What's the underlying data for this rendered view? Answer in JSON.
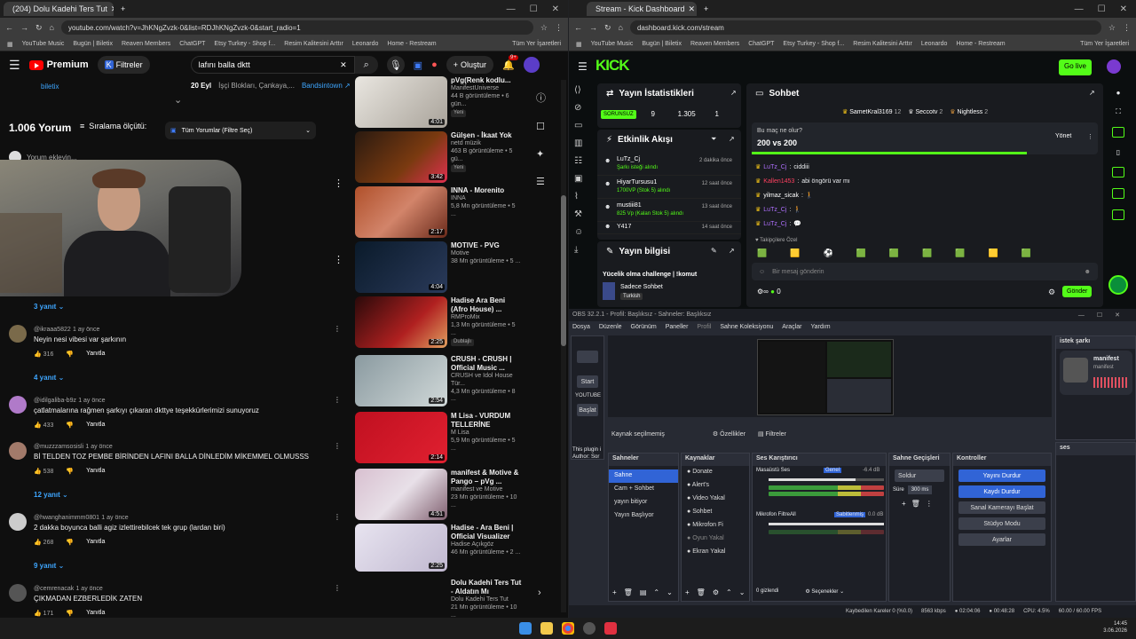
{
  "yt_browser": {
    "tab_title": "(204) Dolu Kadehi Ters Tut",
    "url": "youtube.com/watch?v=JhKNgZvzk-0&list=RDJhKNgZvzk-0&start_radio=1"
  },
  "kick_browser": {
    "tab_title": "Stream - Kick Dashboard",
    "url": "dashboard.kick.com/stream"
  },
  "bookmarks": [
    "YouTube Music",
    "Bugün | Biletix",
    "Reaven Members",
    "ChatGPT",
    "Etsy Turkey - Shop f...",
    "Resim Kalitesini Arttır",
    "Leonardo",
    "Home - Restream"
  ],
  "bookmarks_right": "Tüm Yer İşaretleri",
  "yt": {
    "brand": "Premium",
    "filters": "Filtreler",
    "search": "lafını balla dktt",
    "create": "Oluştur",
    "notif": "9+",
    "biletix": "biletix",
    "date": "20 Eyl",
    "venue": "İşçi Blokları, Çankaya,...",
    "bandsintown": "Bandsintown ↗",
    "comment_count": "1.006 Yorum",
    "sort": "Sıralama ölçütü:",
    "filter_sel": "Tüm Yorumlar (Filtre Seç)",
    "add_comment": "Yorum ekleyin...",
    "comments": [
      {
        "replies": "3 yanıt"
      },
      {
        "user": "@ikraaa5822",
        "age": "1 ay önce",
        "text": "Neyin nesi vibesi var şarkının",
        "likes": "316",
        "reply": "Yanıtla",
        "replies": "4 yanıt"
      },
      {
        "user": "@idilgaliba-b9z",
        "age": "1 ay önce",
        "text": "çatlatmalarına rağmen şarkıyı çıkaran dkttye teşekkürlerimizi sunuyoruz",
        "likes": "433",
        "reply": "Yanıtla"
      },
      {
        "user": "@muzzzamsosisli",
        "age": "1 ay önce",
        "text": "Bİ TELDEN TOZ PEMBE BİRİNDEN LAFINI BALLA DİNLEDİM MİKEMMEL OLMUSSS",
        "likes": "538",
        "reply": "Yanıtla",
        "replies": "12 yanıt"
      },
      {
        "user": "@hwanghanimmm0801",
        "age": "1 ay önce",
        "text": "2 dakka boyunca balli agiz izlettirebilcek tek grup (lardan biri)",
        "likes": "268",
        "reply": "Yanıtla",
        "replies": "9 yanıt"
      },
      {
        "user": "@cemrenacak",
        "age": "1 ay önce",
        "text": "ÇIKMADAN EZBERLEDİK ZATEN",
        "likes": "171",
        "reply": "Yanıtla"
      }
    ],
    "videos": [
      {
        "title": "pVg(Renk kodlu...",
        "channel": "ManifestUniverse",
        "meta": "44 B görüntüleme • 6 gün...",
        "badge": "Yeni",
        "dur": "4:01"
      },
      {
        "title": "Gülşen - İkaat Yok",
        "channel": "netd müzik",
        "meta": "463 B görüntüleme • 5 gü...",
        "badge": "Yeni",
        "dur": "3:42"
      },
      {
        "title": "INNA - Morenito",
        "channel": "INNA",
        "meta": "5,8 Mn görüntüleme • 5 ...",
        "badge": "",
        "dur": "2:17"
      },
      {
        "title": "MOTIVE - PVG",
        "channel": "Motive",
        "meta": "38 Mn görüntüleme • 5 ...",
        "badge": "",
        "dur": "4:04"
      },
      {
        "title": "Hadise Ara Beni (Afro House) ...",
        "channel": "RMProMix",
        "meta": "1,3 Mn görüntüleme • 5 ...",
        "badge": "Dublajlı",
        "dur": "2:25"
      },
      {
        "title": "CRUSH - CRUSH | Official Music ...",
        "channel": "CRUSH ve Idol House Tür...",
        "meta": "4,3 Mn görüntüleme • 8 ...",
        "badge": "",
        "dur": "2:54"
      },
      {
        "title": "M Lisa - VURDUM TELLERİNE",
        "channel": "M Lisa",
        "meta": "5,9 Mn görüntüleme • 5 ...",
        "badge": "",
        "dur": "2:14"
      },
      {
        "title": "manifest & Motive & Pango – pVg ...",
        "channel": "manifest ve Motive",
        "meta": "23 Mn görüntüleme • 10 ...",
        "badge": "",
        "dur": "4:51"
      },
      {
        "title": "Hadise - Ara Beni | Official Visualizer",
        "channel": "Hadise Açıkgöz",
        "meta": "46 Mn görüntüleme • 2 ...",
        "badge": "",
        "dur": "2:25"
      },
      {
        "title": "Dolu Kadehi Ters Tut - Aldatın Mı",
        "channel": "Dolu Kadehi Ters Tut",
        "meta": "21 Mn görüntüleme • 10 ...",
        "badge": "",
        "dur": ""
      }
    ]
  },
  "kick": {
    "golive": "Go live",
    "stats_title": "Yayın İstatistikleri",
    "stat_badge": "SORUNSUZ",
    "stats": [
      "9",
      "1.305",
      "1"
    ],
    "chat_title": "Sohbet",
    "top": [
      {
        "name": "SametKral3169",
        "n": "12"
      },
      {
        "name": "Seccotv",
        "n": "2"
      },
      {
        "name": "Nightless",
        "n": "2"
      }
    ],
    "poll_q": "Bu maç ne olur?",
    "poll_vs": "200 vs 200",
    "poll_btn": "Yönet",
    "activity_title": "Etkinlik Akışı",
    "events": [
      {
        "name": "LuTz_Cj",
        "sub": "Şarkı isteği alındı",
        "time": "2 dakika önce"
      },
      {
        "name": "HiyarTursusu1",
        "sub": "1700VP (Stok 5) alındı",
        "time": "12 saat önce"
      },
      {
        "name": "mustiii81",
        "sub": "825 Vp (Kalan Stok 5) alındı",
        "time": "13 saat önce"
      },
      {
        "name": "Y417",
        "sub": "",
        "time": "14 saat önce"
      }
    ],
    "chat": [
      {
        "user": "LuTz_Cj",
        "msg": "ciddiii"
      },
      {
        "user": "Kallen1453",
        "msg": "abi öngörü var mı"
      },
      {
        "user": "yilmaz_sicak",
        "msg": ""
      },
      {
        "user": "LuTz_Cj",
        "msg": ""
      },
      {
        "user": "LuTz_Cj",
        "msg": ""
      }
    ],
    "followers_only": "Takipçilere Özel",
    "chat_placeholder": "Bir mesaj gönderin",
    "chat_count": "0",
    "send": "Gönder",
    "info_title": "Yayın bilgisi",
    "info_name": "Yücelik olma challenge | !komut",
    "category": "Sadece Sohbet",
    "lang": "Turkish"
  },
  "obs": {
    "title": "OBS 32.2.1 - Profil: Başlıksız - Sahneler: Başlıksız",
    "menu": [
      "Dosya",
      "Düzenle",
      "Görünüm",
      "Paneller",
      "Profil",
      "Sahne Koleksiyonu",
      "Araçlar",
      "Yardım"
    ],
    "source_none": "Kaynak seçilmemiş",
    "props": "Özellikler",
    "filters": "Filtreler",
    "scenes_title": "Sahneler",
    "scenes": [
      "Sahne",
      "Cam + Sohbet",
      "yayın bitiyor",
      "Yayın Başlıyor"
    ],
    "sources_title": "Kaynaklar",
    "sources": [
      "Donate",
      "Alert's",
      "Video Yakal",
      "Sohbet",
      "Mikrofon Fi",
      "Oyun Yakal",
      "Ekran Yakal"
    ],
    "mixer_title": "Ses Karıştırıcı",
    "ch1": "Masaüstü Ses",
    "ch1_db": "-6.4 dB",
    "ch1_tag": "Genel",
    "ch2": "Mikrofon FiltreAll",
    "ch2_db": "0.0 dB",
    "ch2_tag": "Sabitlenmiş",
    "hidden": "0 gizlendi",
    "opts": "Seçenekler",
    "trans_title": "Sahne Geçişleri",
    "trans": "Soldur",
    "dur_label": "Süre",
    "dur": "300 ms",
    "ctrl_title": "Kontroller",
    "ctrl": [
      "Yayını Durdur",
      "Kaydı Durdur",
      "Sanal Kamerayı Başlat",
      "Stüdyo Modu",
      "Ayarlar"
    ],
    "plugin": "This plugin i Author: Sor",
    "start": "Start",
    "youtube": "YOUTUBE",
    "baslat": "Başlat",
    "istek_title": "istek şarkı",
    "song": "manifest",
    "song_sub": "manifest",
    "ses_title": "ses",
    "status": {
      "frames": "Kaybedilen Kareler 0 (%0.0)",
      "kbps": "8563 kbps",
      "live": "02:04:06",
      "rec": "00:48:28",
      "cpu": "CPU: 4.5%",
      "fps": "60.00 / 60.00 FPS"
    }
  },
  "clock": {
    "time": "14:45",
    "date": "3.06.2026"
  },
  "colors": {
    "kick_green": "#53fc18",
    "yt_red": "#ff0000",
    "obs_blue": "#3164d6"
  }
}
